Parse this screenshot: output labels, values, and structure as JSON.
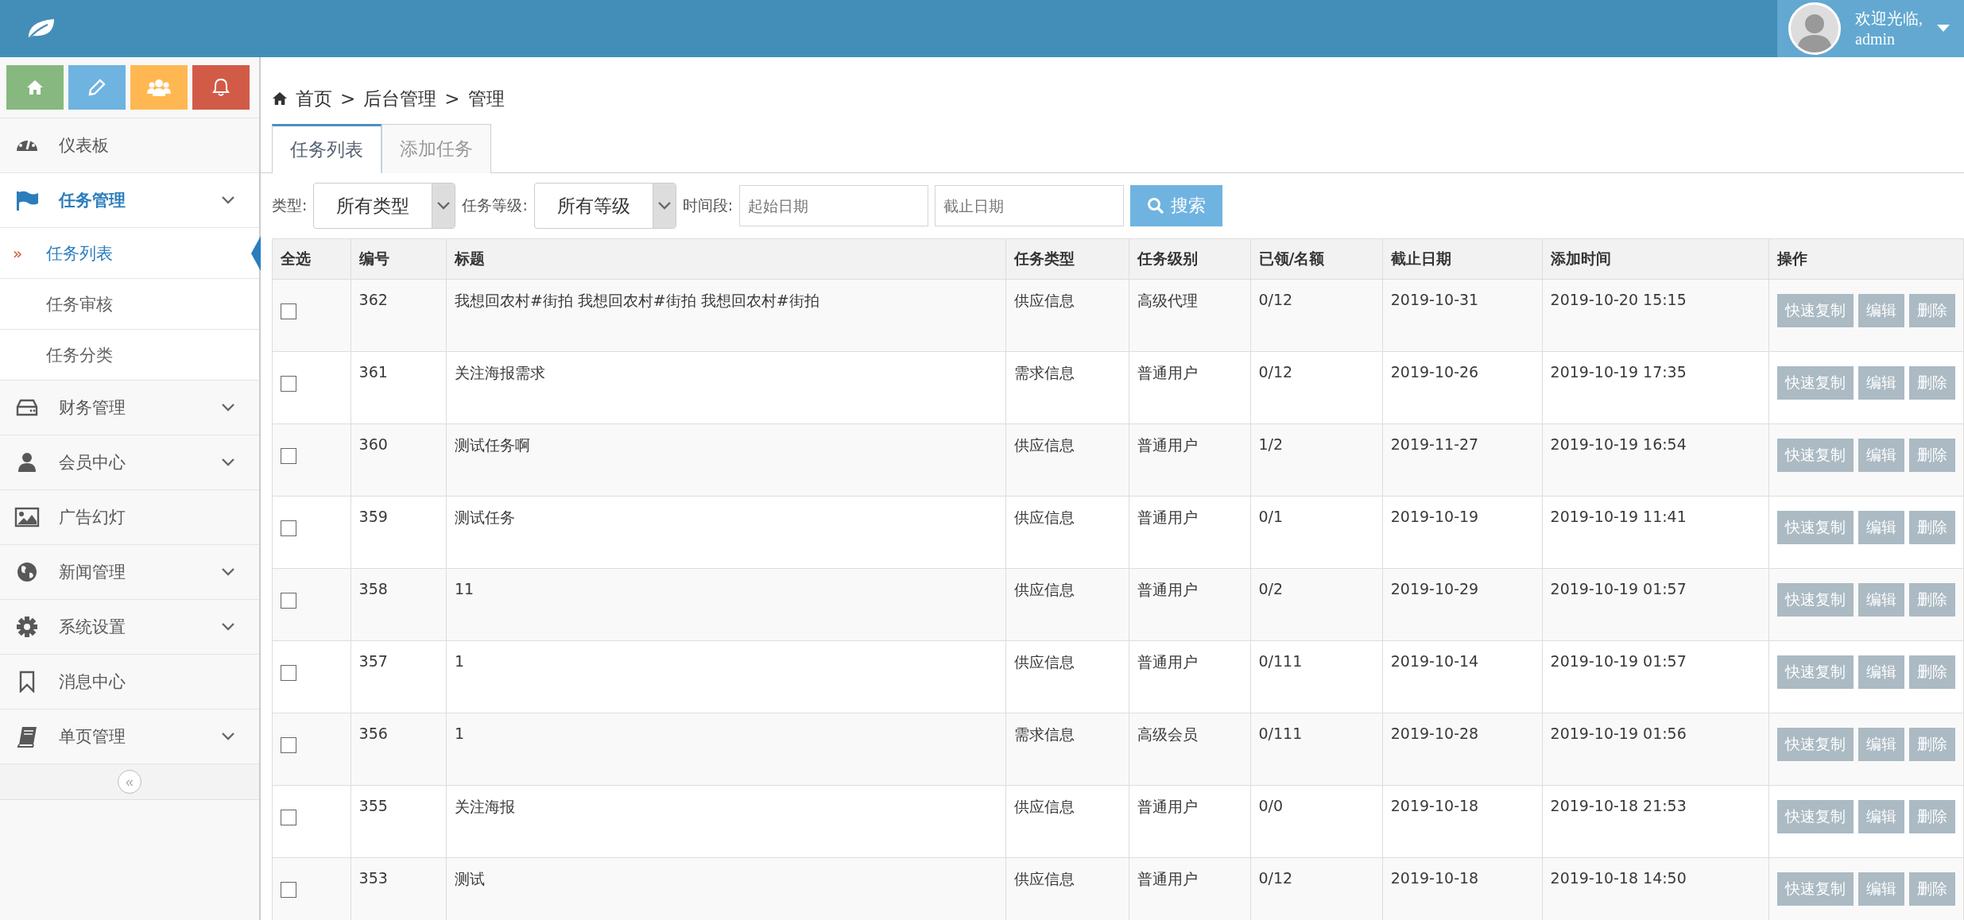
{
  "header": {
    "greeting": "欢迎光临,",
    "user": "admin"
  },
  "shortcuts": [
    {
      "color": "#87b87f"
    },
    {
      "color": "#6fb3e0"
    },
    {
      "color": "#ffb752"
    },
    {
      "color": "#d15b47"
    }
  ],
  "sidebar": {
    "current_marker": "»",
    "collapse_button": "«",
    "items": [
      {
        "label": "仪表板",
        "selected": false,
        "expandable": false
      },
      {
        "label": "任务管理",
        "selected": true,
        "expandable": true,
        "children": [
          {
            "label": "任务列表",
            "selected": true
          },
          {
            "label": "任务审核",
            "selected": false
          },
          {
            "label": "任务分类",
            "selected": false
          }
        ]
      },
      {
        "label": "财务管理",
        "selected": false,
        "expandable": true
      },
      {
        "label": "会员中心",
        "selected": false,
        "expandable": true
      },
      {
        "label": "广告幻灯",
        "selected": false,
        "expandable": false
      },
      {
        "label": "新闻管理",
        "selected": false,
        "expandable": true
      },
      {
        "label": "系统设置",
        "selected": false,
        "expandable": true
      },
      {
        "label": "消息中心",
        "selected": false,
        "expandable": false
      },
      {
        "label": "单页管理",
        "selected": false,
        "expandable": true
      }
    ]
  },
  "breadcrumb": [
    {
      "text": "首页"
    },
    {
      "separator": ">",
      "text": "后台管理"
    },
    {
      "separator": ">",
      "text": "管理"
    }
  ],
  "tabs": [
    {
      "label": "任务列表",
      "selected": true
    },
    {
      "label": "添加任务",
      "selected": false
    }
  ],
  "filters": {
    "type_label": "类型:",
    "type_value": "所有类型",
    "level_label": "任务等级:",
    "level_value": "所有等级",
    "period_label": "时间段:",
    "start_placeholder": "起始日期",
    "end_placeholder": "截止日期",
    "search": "搜索"
  },
  "table": {
    "select_all": "全选",
    "columns": [
      "编号",
      "标题",
      "任务类型",
      "任务级别",
      "已领/名额",
      "截止日期",
      "添加时间"
    ],
    "actions_header": "操作",
    "rows": [
      {
        "checked": false,
        "cells": [
          "362",
          "我想回农村#街拍 我想回农村#街拍 我想回农村#街拍",
          "供应信息",
          "高级代理",
          "0/12",
          "2019-10-31",
          "2019-10-20 15:15"
        ],
        "actions": [
          "快速复制",
          "编辑",
          "删除"
        ]
      },
      {
        "checked": false,
        "cells": [
          "361",
          "关注海报需求",
          "需求信息",
          "普通用户",
          "0/12",
          "2019-10-26",
          "2019-10-19 17:35"
        ],
        "actions": [
          "快速复制",
          "编辑",
          "删除"
        ]
      },
      {
        "checked": false,
        "cells": [
          "360",
          "测试任务啊",
          "供应信息",
          "普通用户",
          "1/2",
          "2019-11-27",
          "2019-10-19 16:54"
        ],
        "actions": [
          "快速复制",
          "编辑",
          "删除"
        ]
      },
      {
        "checked": false,
        "cells": [
          "359",
          "测试任务",
          "供应信息",
          "普通用户",
          "0/1",
          "2019-10-19",
          "2019-10-19 11:41"
        ],
        "actions": [
          "快速复制",
          "编辑",
          "删除"
        ]
      },
      {
        "checked": false,
        "cells": [
          "358",
          "11",
          "供应信息",
          "普通用户",
          "0/2",
          "2019-10-29",
          "2019-10-19 01:57"
        ],
        "actions": [
          "快速复制",
          "编辑",
          "删除"
        ]
      },
      {
        "checked": false,
        "cells": [
          "357",
          "1",
          "供应信息",
          "普通用户",
          "0/111",
          "2019-10-14",
          "2019-10-19 01:57"
        ],
        "actions": [
          "快速复制",
          "编辑",
          "删除"
        ]
      },
      {
        "checked": false,
        "cells": [
          "356",
          "1",
          "需求信息",
          "高级会员",
          "0/111",
          "2019-10-28",
          "2019-10-19 01:56"
        ],
        "actions": [
          "快速复制",
          "编辑",
          "删除"
        ]
      },
      {
        "checked": false,
        "cells": [
          "355",
          "关注海报",
          "供应信息",
          "普通用户",
          "0/0",
          "2019-10-18",
          "2019-10-18 21:53"
        ],
        "actions": [
          "快速复制",
          "编辑",
          "删除"
        ]
      },
      {
        "checked": false,
        "cells": [
          "353",
          "测试",
          "供应信息",
          "普通用户",
          "0/12",
          "2019-10-18",
          "2019-10-18 14:50"
        ],
        "actions": [
          "快速复制",
          "编辑",
          "删除"
        ]
      }
    ]
  }
}
